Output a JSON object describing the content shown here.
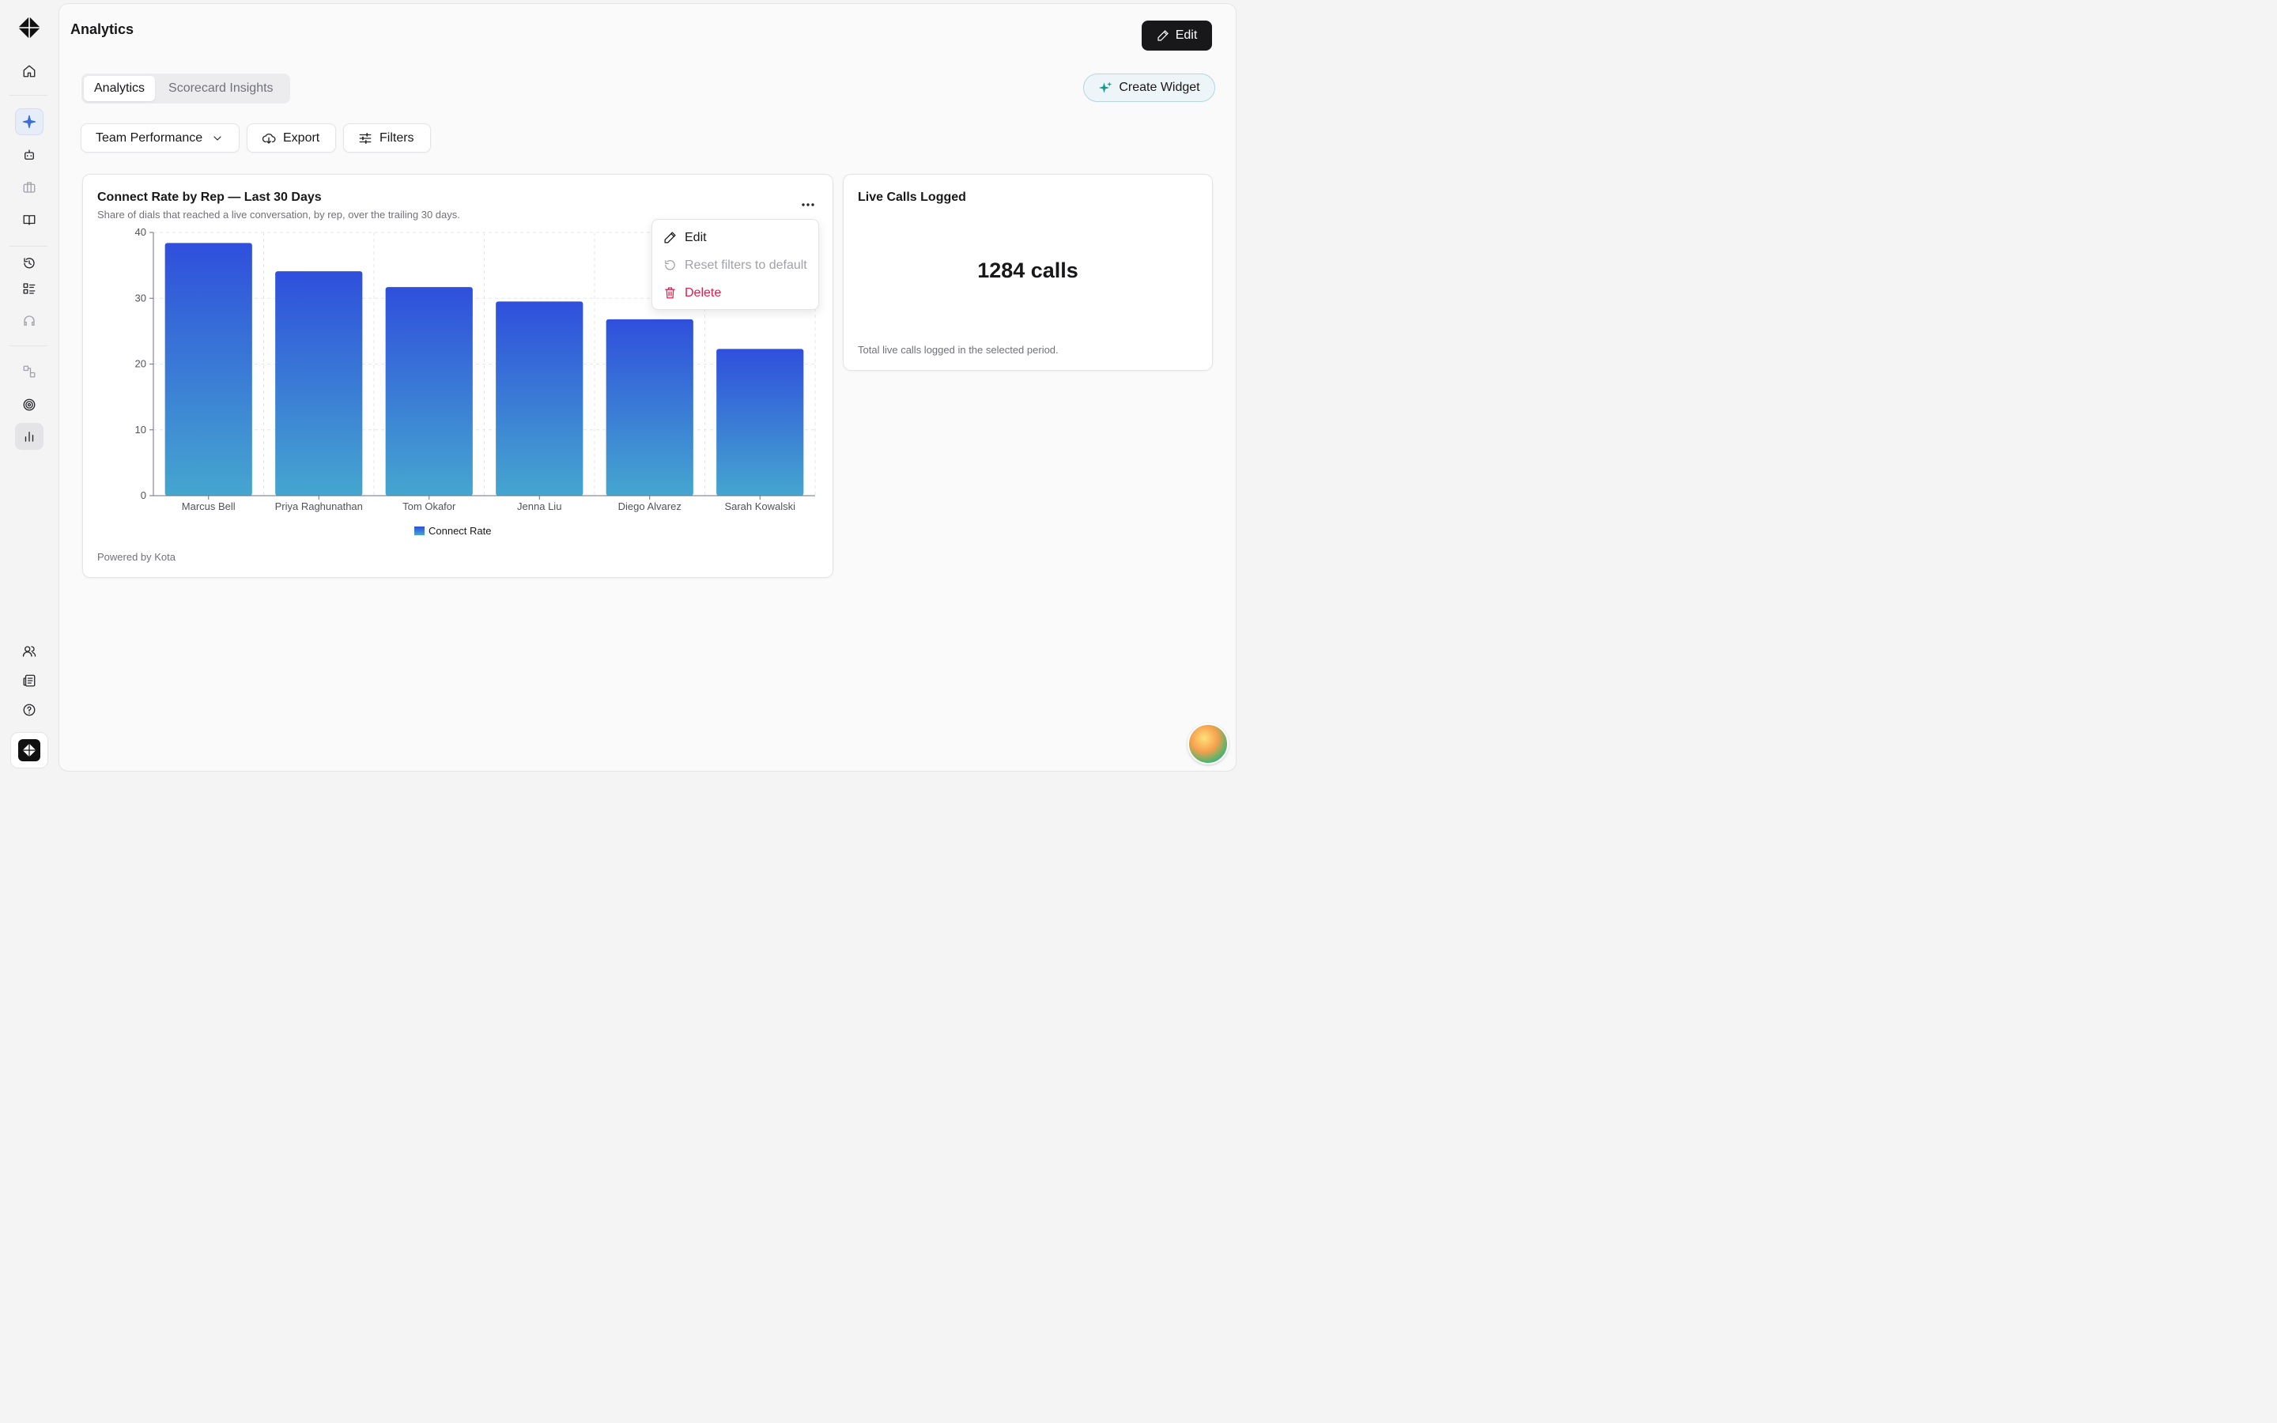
{
  "page": {
    "title": "Analytics",
    "edit_label": "Edit"
  },
  "tabs": [
    {
      "label": "Analytics",
      "active": true
    },
    {
      "label": "Scorecard Insights",
      "active": false
    }
  ],
  "create_widget_label": "Create Widget",
  "toolbar": {
    "dashboard_select": "Team Performance",
    "export_label": "Export",
    "filters_label": "Filters"
  },
  "chart_card": {
    "title": "Connect Rate by Rep — Last 30 Days",
    "subtitle": "Share of dials that reached a live conversation, by rep, over the trailing 30 days.",
    "footer": "Powered by Kota"
  },
  "context_menu": {
    "edit": "Edit",
    "reset": "Reset filters to default",
    "delete": "Delete"
  },
  "metric_card": {
    "title": "Live Calls Logged",
    "value": "1284 calls",
    "description": "Total live calls logged in the selected period."
  },
  "colors": {
    "bar_top": "#2f4fdc",
    "bar_bottom": "#45a6cf",
    "accent": "#3b6fd8",
    "danger": "#e11d48"
  },
  "chart_data": {
    "type": "bar",
    "categories": [
      "Marcus Bell",
      "Priya Raghunathan",
      "Tom Okafor",
      "Jenna Liu",
      "Diego Alvarez",
      "Sarah Kowalski"
    ],
    "series": [
      {
        "name": "Connect Rate",
        "values": [
          38.4,
          34.1,
          31.7,
          29.5,
          26.8,
          22.3
        ]
      }
    ],
    "yticks": [
      "0",
      "10",
      "20",
      "30",
      "40"
    ],
    "ylim": [
      0,
      40
    ],
    "grid": true,
    "legend": "bottom-center"
  }
}
